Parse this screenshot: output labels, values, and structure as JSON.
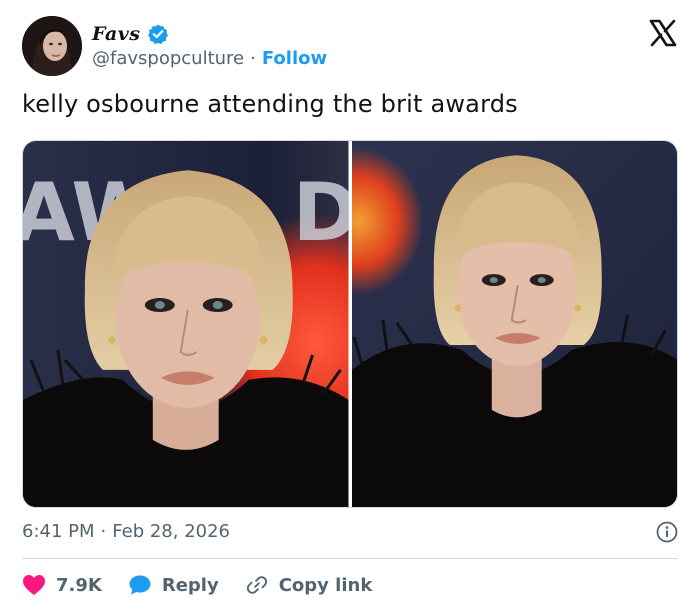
{
  "author": {
    "display_name": "Favs",
    "handle": "@favspopculture",
    "separator": "·",
    "follow_label": "Follow",
    "verified": true
  },
  "tweet": {
    "text": "kelly osbourne attending the brit awards"
  },
  "footer": {
    "time": "6:41 PM",
    "separator": "·",
    "date": "Feb 28, 2026"
  },
  "actions": {
    "likes": "7.9K",
    "reply_label": "Reply",
    "copy_label": "Copy link"
  },
  "colors": {
    "accent": "#1d9bf0",
    "like": "#f91880",
    "secondary_text": "#536471",
    "primary_text": "#0f1419"
  },
  "icons": {
    "brand": "x-logo-icon",
    "verified": "verified-badge-icon",
    "like": "heart-icon",
    "reply": "speech-bubble-icon",
    "copy": "link-icon",
    "info": "info-icon"
  }
}
